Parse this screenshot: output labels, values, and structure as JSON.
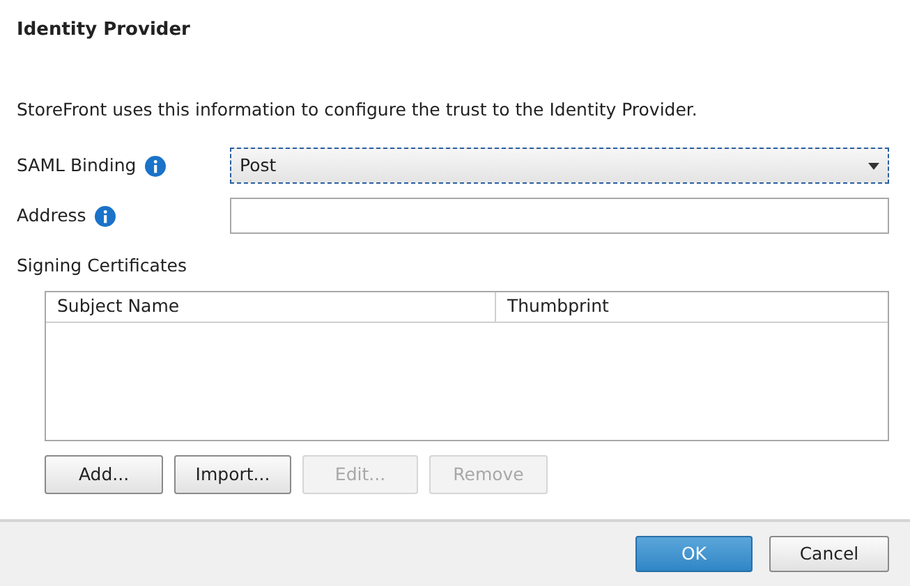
{
  "title": "Identity Provider",
  "description": "StoreFront uses this information to configure the trust to the Identity Provider.",
  "fields": [
    {
      "kind": "select",
      "label": "SAML Binding",
      "value": "Post",
      "focused": true
    },
    {
      "kind": "text",
      "label": "Address",
      "focused": false
    }
  ],
  "certificates": {
    "label": "Signing Certificates",
    "columns": [
      "Subject Name",
      "Thumbprint"
    ]
  },
  "table_buttons": [
    {
      "label": "Add...",
      "disabled": false
    },
    {
      "label": "Import...",
      "disabled": false
    },
    {
      "label": "Edit...",
      "disabled": true
    },
    {
      "label": "Remove",
      "disabled": true
    }
  ],
  "footer_buttons": [
    {
      "label": "OK",
      "primary": true
    },
    {
      "label": "Cancel",
      "primary": false
    }
  ]
}
